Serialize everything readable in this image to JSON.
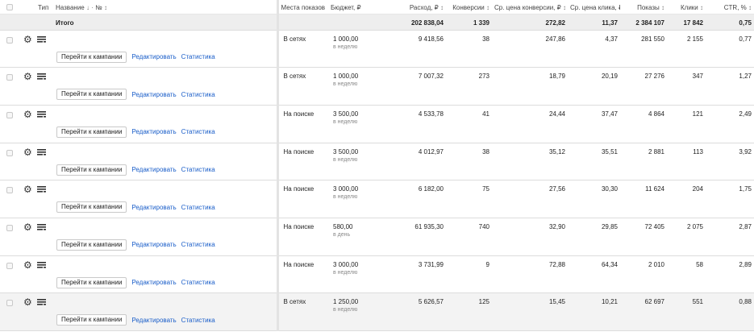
{
  "header": {
    "type": "Тип",
    "name": "Название",
    "name_sort": "↓",
    "dot": "·",
    "number": "№",
    "number_sort": "↕",
    "places": "Места показов",
    "budget": "Бюджет, ₽",
    "spend": "Расход, ₽",
    "spend_sort": "↕",
    "conversions": "Конверсии",
    "conversions_sort": "↕",
    "cpa": "Ср. цена конверсии, ₽",
    "cpa_sort": "↕",
    "cpc": "Ср. цена клика, ₽",
    "cpc_sort": "↕",
    "impressions": "Показы",
    "impressions_sort": "↕",
    "clicks": "Клики",
    "clicks_sort": "↕",
    "ctr": "CTR, %",
    "ctr_sort": "↕"
  },
  "total": {
    "label": "Итого",
    "spend": "202 838,04",
    "conversions": "1 339",
    "cpa": "272,82",
    "cpc": "11,37",
    "impressions": "2 384 107",
    "clicks": "17 842",
    "ctr": "0,75"
  },
  "actions": {
    "go_label": "Перейти к кампании",
    "edit_label": "Редактировать",
    "stats_label": "Статистика"
  },
  "rows": [
    {
      "places": "В сетях",
      "budget": "1 000,00",
      "period": "в неделю",
      "spend": "9 418,56",
      "conversions": "38",
      "cpa": "247,86",
      "cpc": "4,37",
      "impressions": "281 550",
      "clicks": "2 155",
      "ctr": "0,77"
    },
    {
      "places": "В сетях",
      "budget": "1 000,00",
      "period": "в неделю",
      "spend": "7 007,32",
      "conversions": "273",
      "cpa": "18,79",
      "cpc": "20,19",
      "impressions": "27 276",
      "clicks": "347",
      "ctr": "1,27"
    },
    {
      "places": "На поиске",
      "budget": "3 500,00",
      "period": "в неделю",
      "spend": "4 533,78",
      "conversions": "41",
      "cpa": "24,44",
      "cpc": "37,47",
      "impressions": "4 864",
      "clicks": "121",
      "ctr": "2,49"
    },
    {
      "places": "На поиске",
      "budget": "3 500,00",
      "period": "в неделю",
      "spend": "4 012,97",
      "conversions": "38",
      "cpa": "35,12",
      "cpc": "35,51",
      "impressions": "2 881",
      "clicks": "113",
      "ctr": "3,92"
    },
    {
      "places": "На поиске",
      "budget": "3 000,00",
      "period": "в неделю",
      "spend": "6 182,00",
      "conversions": "75",
      "cpa": "27,56",
      "cpc": "30,30",
      "impressions": "11 624",
      "clicks": "204",
      "ctr": "1,75"
    },
    {
      "places": "На поиске",
      "budget": "580,00",
      "period": "в день",
      "spend": "61 935,30",
      "conversions": "740",
      "cpa": "32,90",
      "cpc": "29,85",
      "impressions": "72 405",
      "clicks": "2 075",
      "ctr": "2,87"
    },
    {
      "places": "На поиске",
      "budget": "3 000,00",
      "period": "в неделю",
      "spend": "3 731,99",
      "conversions": "9",
      "cpa": "72,88",
      "cpc": "64,34",
      "impressions": "2 010",
      "clicks": "58",
      "ctr": "2,89"
    },
    {
      "places": "В сетях",
      "budget": "1 250,00",
      "period": "в неделю",
      "spend": "5 626,57",
      "conversions": "125",
      "cpa": "15,45",
      "cpc": "10,21",
      "impressions": "62 697",
      "clicks": "551",
      "ctr": "0,88"
    }
  ]
}
